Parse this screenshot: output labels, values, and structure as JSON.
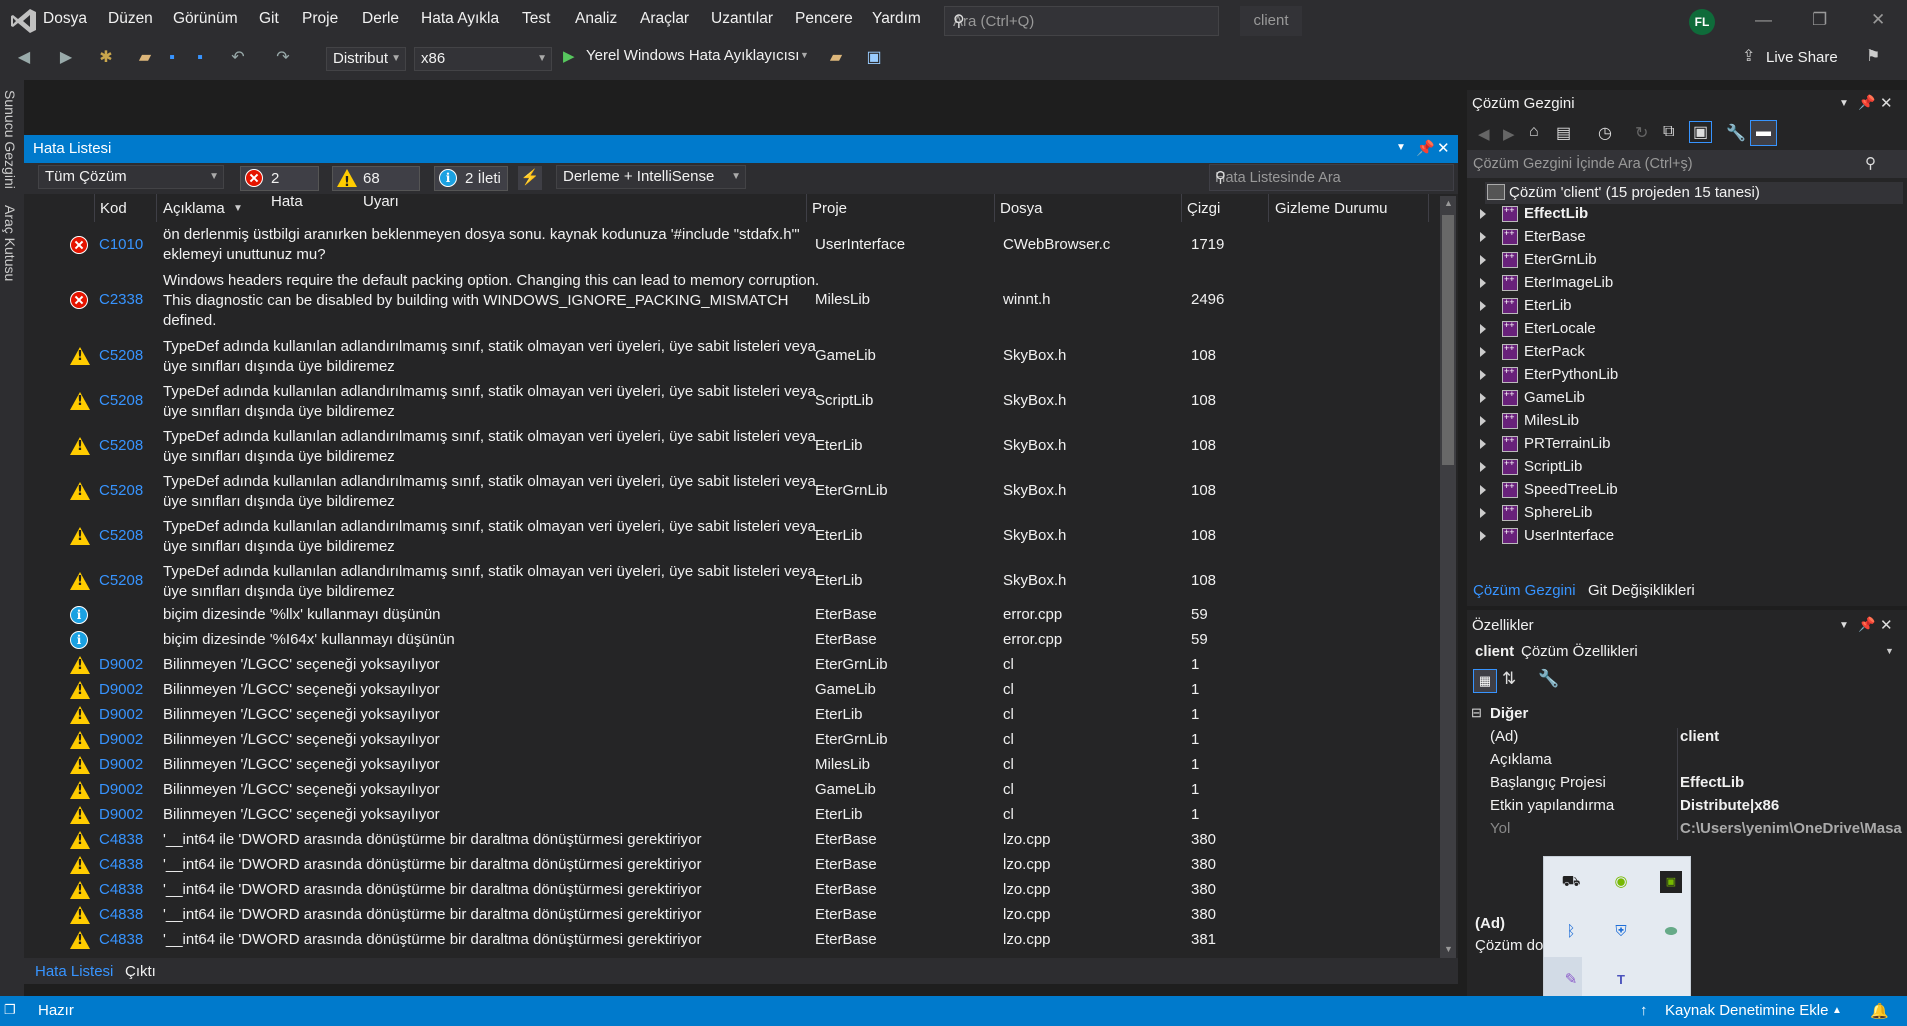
{
  "app": {
    "menu": [
      "Dosya",
      "Düzen",
      "Görünüm",
      "Git",
      "Proje",
      "Derle",
      "Hata Ayıkla",
      "Test",
      "Analiz",
      "Araçlar",
      "Uzantılar",
      "Pencere",
      "Yardım"
    ],
    "search_placeholder": "Ara (Ctrl+Q)",
    "solution_title": "client",
    "avatar_initials": "FL",
    "live_share": "Live Share"
  },
  "toolbar": {
    "config": "Distribut",
    "platform": "x86",
    "debug_target": "Yerel Windows Hata Ayıklayıcısı"
  },
  "left_strip": {
    "server_explorer": "Sunucu Gezgini",
    "toolbox": "Araç Kutusu"
  },
  "error_list": {
    "title": "Hata Listesi",
    "scope": "Tüm Çözüm",
    "errors_btn": "2 Hata",
    "warnings_btn": "68 Uyarı",
    "messages_btn": "2 İleti",
    "build_filter": "Derleme + IntelliSense",
    "search_placeholder": "Hata Listesinde Ara",
    "headers": {
      "code": "Kod",
      "desc": "Açıklama",
      "project": "Proje",
      "file": "Dosya",
      "line": "Çizgi",
      "suppress": "Gizleme Durumu"
    },
    "rows": [
      {
        "type": "error",
        "code": "C1010",
        "desc": "ön derlenmiş üstbilgi aranırken beklenmeyen dosya sonu. kaynak kodunuza '#include \"stdafx.h\"' eklemeyi unuttunuz mu?",
        "project": "UserInterface",
        "file": "CWebBrowser.c",
        "line": "1719"
      },
      {
        "type": "error",
        "code": "C2338",
        "desc": "Windows headers require the default packing option. Changing this can lead to memory corruption. This diagnostic can be disabled by building with WINDOWS_IGNORE_PACKING_MISMATCH defined.",
        "project": "MilesLib",
        "file": "winnt.h",
        "line": "2496"
      },
      {
        "type": "warn",
        "code": "C5208",
        "desc": "TypeDef adında kullanılan adlandırılmamış sınıf, statik olmayan veri üyeleri, üye sabit listeleri veya üye sınıfları dışında üye bildiremez",
        "project": "GameLib",
        "file": "SkyBox.h",
        "line": "108"
      },
      {
        "type": "warn",
        "code": "C5208",
        "desc": "TypeDef adında kullanılan adlandırılmamış sınıf, statik olmayan veri üyeleri, üye sabit listeleri veya üye sınıfları dışında üye bildiremez",
        "project": "ScriptLib",
        "file": "SkyBox.h",
        "line": "108"
      },
      {
        "type": "warn",
        "code": "C5208",
        "desc": "TypeDef adında kullanılan adlandırılmamış sınıf, statik olmayan veri üyeleri, üye sabit listeleri veya üye sınıfları dışında üye bildiremez",
        "project": "EterLib",
        "file": "SkyBox.h",
        "line": "108"
      },
      {
        "type": "warn",
        "code": "C5208",
        "desc": "TypeDef adında kullanılan adlandırılmamış sınıf, statik olmayan veri üyeleri, üye sabit listeleri veya üye sınıfları dışında üye bildiremez",
        "project": "EterGrnLib",
        "file": "SkyBox.h",
        "line": "108"
      },
      {
        "type": "warn",
        "code": "C5208",
        "desc": "TypeDef adında kullanılan adlandırılmamış sınıf, statik olmayan veri üyeleri, üye sabit listeleri veya üye sınıfları dışında üye bildiremez",
        "project": "EterLib",
        "file": "SkyBox.h",
        "line": "108"
      },
      {
        "type": "warn",
        "code": "C5208",
        "desc": "TypeDef adında kullanılan adlandırılmamış sınıf, statik olmayan veri üyeleri, üye sabit listeleri veya üye sınıfları dışında üye bildiremez",
        "project": "EterLib",
        "file": "SkyBox.h",
        "line": "108"
      },
      {
        "type": "info",
        "code": "",
        "desc": "biçim dizesinde '%llx' kullanmayı düşünün",
        "project": "EterBase",
        "file": "error.cpp",
        "line": "59"
      },
      {
        "type": "info",
        "code": "",
        "desc": "biçim dizesinde '%I64x' kullanmayı düşünün",
        "project": "EterBase",
        "file": "error.cpp",
        "line": "59"
      },
      {
        "type": "warn",
        "code": "D9002",
        "desc": "Bilinmeyen '/LGCC' seçeneği yoksayılıyor",
        "project": "EterGrnLib",
        "file": "cl",
        "line": "1"
      },
      {
        "type": "warn",
        "code": "D9002",
        "desc": "Bilinmeyen '/LGCC' seçeneği yoksayılıyor",
        "project": "GameLib",
        "file": "cl",
        "line": "1"
      },
      {
        "type": "warn",
        "code": "D9002",
        "desc": "Bilinmeyen '/LGCC' seçeneği yoksayılıyor",
        "project": "EterLib",
        "file": "cl",
        "line": "1"
      },
      {
        "type": "warn",
        "code": "D9002",
        "desc": "Bilinmeyen '/LGCC' seçeneği yoksayılıyor",
        "project": "EterGrnLib",
        "file": "cl",
        "line": "1"
      },
      {
        "type": "warn",
        "code": "D9002",
        "desc": "Bilinmeyen '/LGCC' seçeneği yoksayılıyor",
        "project": "MilesLib",
        "file": "cl",
        "line": "1"
      },
      {
        "type": "warn",
        "code": "D9002",
        "desc": "Bilinmeyen '/LGCC' seçeneği yoksayılıyor",
        "project": "GameLib",
        "file": "cl",
        "line": "1"
      },
      {
        "type": "warn",
        "code": "D9002",
        "desc": "Bilinmeyen '/LGCC' seçeneği yoksayılıyor",
        "project": "EterLib",
        "file": "cl",
        "line": "1"
      },
      {
        "type": "warn",
        "code": "C4838",
        "desc": "'__int64 ile 'DWORD arasında dönüştürme bir daraltma dönüştürmesi gerektiriyor",
        "project": "EterBase",
        "file": "lzo.cpp",
        "line": "380"
      },
      {
        "type": "warn",
        "code": "C4838",
        "desc": "'__int64 ile 'DWORD arasında dönüştürme bir daraltma dönüştürmesi gerektiriyor",
        "project": "EterBase",
        "file": "lzo.cpp",
        "line": "380"
      },
      {
        "type": "warn",
        "code": "C4838",
        "desc": "'__int64 ile 'DWORD arasında dönüştürme bir daraltma dönüştürmesi gerektiriyor",
        "project": "EterBase",
        "file": "lzo.cpp",
        "line": "380"
      },
      {
        "type": "warn",
        "code": "C4838",
        "desc": "'__int64 ile 'DWORD arasında dönüştürme bir daraltma dönüştürmesi gerektiriyor",
        "project": "EterBase",
        "file": "lzo.cpp",
        "line": "380"
      },
      {
        "type": "warn",
        "code": "C4838",
        "desc": "'__int64 ile 'DWORD arasında dönüştürme bir daraltma dönüştürmesi gerektiriyor",
        "project": "EterBase",
        "file": "lzo.cpp",
        "line": "381"
      }
    ],
    "tabs": [
      "Hata Listesi",
      "Çıktı"
    ]
  },
  "solution_explorer": {
    "title": "Çözüm Gezgini",
    "search_placeholder": "Çözüm Gezgini İçinde Ara (Ctrl+ş)",
    "root": "Çözüm 'client' (15 projeden 15 tanesi)",
    "projects": [
      "EffectLib",
      "EterBase",
      "EterGrnLib",
      "EterImageLib",
      "EterLib",
      "EterLocale",
      "EterPack",
      "EterPythonLib",
      "GameLib",
      "MilesLib",
      "PRTerrainLib",
      "ScriptLib",
      "SpeedTreeLib",
      "SphereLib",
      "UserInterface"
    ],
    "tabs": [
      "Çözüm Gezgini",
      "Git Değişiklikleri"
    ]
  },
  "properties": {
    "title": "Özellikler",
    "object": "client",
    "object_type": "Çözüm Özellikleri",
    "category": "Diğer",
    "rows": [
      {
        "label": "(Ad)",
        "value": "client"
      },
      {
        "label": "Açıklama",
        "value": ""
      },
      {
        "label": "Başlangıç Projesi",
        "value": "EffectLib"
      },
      {
        "label": "Etkin yapılandırma",
        "value": "Distribute|x86"
      },
      {
        "label": "Yol",
        "value": "C:\\Users\\yenim\\OneDrive\\Masa"
      }
    ],
    "desc_title": "(Ad)",
    "desc_text": "Çözüm do"
  },
  "statusbar": {
    "ready": "Hazır",
    "source_control": "Kaynak Denetimine Ekle"
  }
}
